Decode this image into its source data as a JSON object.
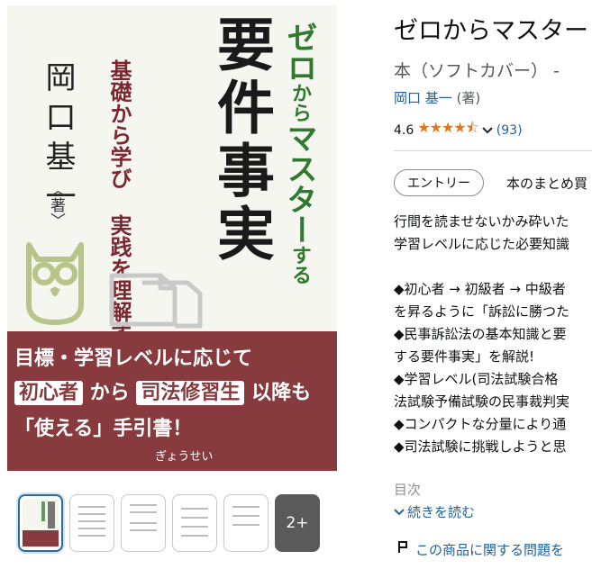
{
  "cover": {
    "author": "岡口基一",
    "author_note": "〈著〉",
    "subtitle_line1": "基礎から学び",
    "subtitle_line2": "実践を理解する",
    "series_prefix": "ゼロ",
    "series_from": "から",
    "series_master": "マスター",
    "series_suru": "する",
    "main_title": "要件事実",
    "band_line1": "目標・学習レベルに応じて",
    "band_hl1": "初心者",
    "band_mid": "から",
    "band_hl2": "司法修習生",
    "band_end": "以降も",
    "band_line3": "「使える」手引書！",
    "publisher": "ぎょうせい"
  },
  "thumbnails": {
    "more_label": "2+"
  },
  "product": {
    "title": "ゼロからマスター",
    "format": "本（ソフトカバー） -",
    "author_link": "岡口 基一",
    "author_role": "(著)",
    "rating_value": "4.6",
    "stars": "★★★★⯪",
    "rating_count": "(93)",
    "pill_label": "エントリー",
    "summary_tab": "本のまとめ買"
  },
  "description": [
    "行間を読ませないかみ砕いた",
    "学習レベルに応じた必要知識",
    "",
    "◆初心者 → 初級者 → 中級者",
    "を昇るように「訴訟に勝つた",
    "◆民事訴訟法の基本知識と要",
    "する要件事実」を解説!",
    "◆学習レベル(司法試験合格",
    "法試験予備試験の民事裁判実",
    "◆コンパクトな分量により通",
    "◆司法試験に挑戦しようと思"
  ],
  "toc_label": "目次",
  "read_more": "続きを読む",
  "report_link": "この商品に関する問題を"
}
